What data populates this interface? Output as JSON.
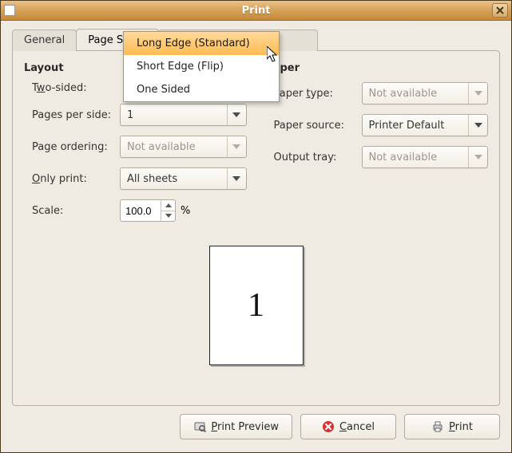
{
  "window": {
    "title": "Print"
  },
  "tabs": {
    "general": "General",
    "page_setup": "Page Setup"
  },
  "two_sided_menu": {
    "long_edge": "Long Edge (Standard)",
    "short_edge": "Short Edge (Flip)",
    "one_sided": "One Sided"
  },
  "layout": {
    "title": "Layout",
    "two_sided_label_pre": "T",
    "two_sided_label_u": "w",
    "two_sided_label_post": "o-sided:",
    "pages_per_side_label": "Pages per side:",
    "pages_per_side_value": "1",
    "page_ordering_label": "Page ordering:",
    "page_ordering_value": "Not available",
    "only_print_label_u": "O",
    "only_print_label_post": "nly print:",
    "only_print_value": "All sheets",
    "scale_label": "Scale:",
    "scale_value": "100.0",
    "scale_suffix": "%"
  },
  "paper": {
    "title": "Paper",
    "paper_type_label_pre": "Paper ",
    "paper_type_label_u": "t",
    "paper_type_label_post": "ype:",
    "paper_type_value": "Not available",
    "paper_source_label": "Paper source:",
    "paper_source_value": "Printer Default",
    "output_tray_label": "Output tray:",
    "output_tray_value": "Not available"
  },
  "preview": {
    "page_number": "1"
  },
  "buttons": {
    "print_preview_u": "P",
    "print_preview_post": "rint Preview",
    "cancel_u": "C",
    "cancel_post": "ancel",
    "print_u": "P",
    "print_post": "rint"
  }
}
